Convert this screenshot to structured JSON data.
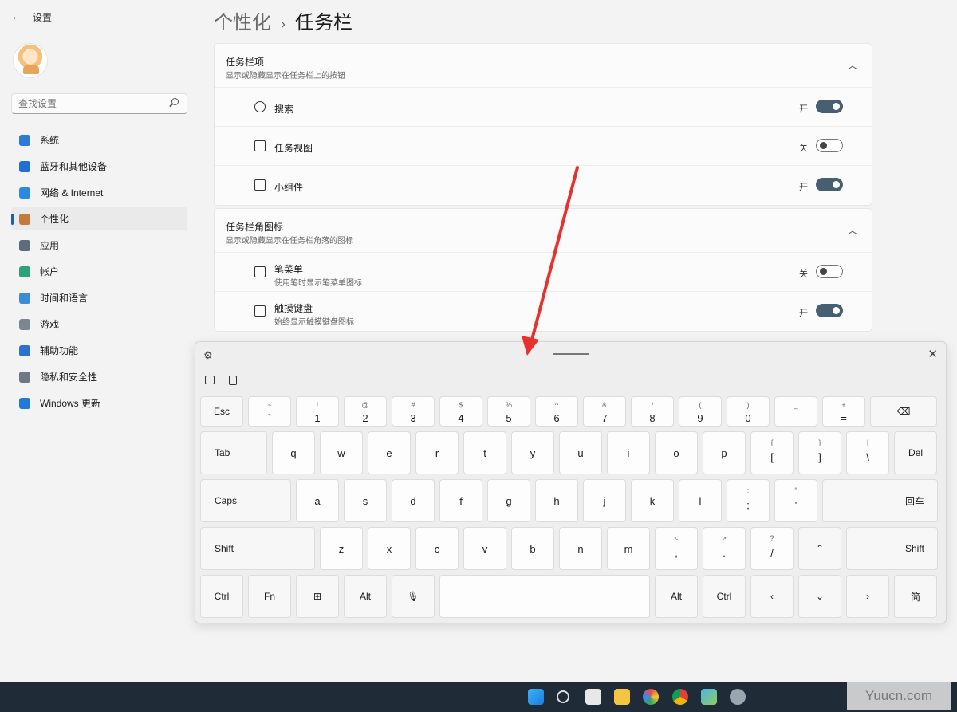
{
  "app": {
    "back_glyph": "←",
    "title": "设置"
  },
  "search": {
    "placeholder": "查找设置"
  },
  "sidebar": {
    "items": [
      {
        "label": "系统",
        "color": "#2d7bd4"
      },
      {
        "label": "蓝牙和其他设备",
        "color": "#1f6fd6"
      },
      {
        "label": "网络 & Internet",
        "color": "#2b8ae0"
      },
      {
        "label": "个性化",
        "color": "#c47a3a"
      },
      {
        "label": "应用",
        "color": "#5a6c7d"
      },
      {
        "label": "帐户",
        "color": "#2aa37a"
      },
      {
        "label": "时间和语言",
        "color": "#3a8dd6"
      },
      {
        "label": "游戏",
        "color": "#7a8793"
      },
      {
        "label": "辅助功能",
        "color": "#2c73cf"
      },
      {
        "label": "隐私和安全性",
        "color": "#6d7a86"
      },
      {
        "label": "Windows 更新",
        "color": "#1f7bd6"
      }
    ],
    "active_index": 3
  },
  "breadcrumb": {
    "parent": "个性化",
    "separator": "›",
    "current": "任务栏"
  },
  "taskbar_items": {
    "title": "任务栏项",
    "subtitle": "显示或隐藏显示在任务栏上的按钮",
    "rows": [
      {
        "label": "搜索",
        "state": "开",
        "on": true
      },
      {
        "label": "任务视图",
        "state": "关",
        "on": false
      },
      {
        "label": "小组件",
        "state": "开",
        "on": true
      }
    ]
  },
  "corner_icons": {
    "title": "任务栏角图标",
    "subtitle": "显示或隐藏显示在任务栏角落的图标",
    "rows": [
      {
        "label": "笔菜单",
        "desc": "使用笔时显示笔菜单图标",
        "state": "关",
        "on": false
      },
      {
        "label": "触摸键盘",
        "desc": "始终显示触摸键盘图标",
        "state": "开",
        "on": true
      }
    ]
  },
  "keyboard": {
    "gear": "⚙",
    "close": "✕",
    "row1": [
      {
        "up": "",
        "lo": "Esc"
      },
      {
        "up": "~",
        "lo": "`"
      },
      {
        "up": "!",
        "lo": "1"
      },
      {
        "up": "@",
        "lo": "2"
      },
      {
        "up": "#",
        "lo": "3"
      },
      {
        "up": "$",
        "lo": "4"
      },
      {
        "up": "%",
        "lo": "5"
      },
      {
        "up": "^",
        "lo": "6"
      },
      {
        "up": "&",
        "lo": "7"
      },
      {
        "up": "*",
        "lo": "8"
      },
      {
        "up": "(",
        "lo": "9"
      },
      {
        "up": ")",
        "lo": "0"
      },
      {
        "up": "_",
        "lo": "-"
      },
      {
        "up": "+",
        "lo": "="
      },
      {
        "up": "",
        "lo": "⌫"
      }
    ],
    "row2": [
      "Tab",
      "q",
      "w",
      "e",
      "r",
      "t",
      "y",
      "u",
      "i",
      "o",
      "p"
    ],
    "row2_sym": [
      {
        "up": "{",
        "lo": "["
      },
      {
        "up": "}",
        "lo": "]"
      },
      {
        "up": "|",
        "lo": "\\"
      }
    ],
    "row2_end": "Del",
    "row3": [
      "Caps",
      "a",
      "s",
      "d",
      "f",
      "g",
      "h",
      "j",
      "k",
      "l"
    ],
    "row3_sym": [
      {
        "up": ":",
        "lo": ";"
      },
      {
        "up": "\"",
        "lo": "'"
      }
    ],
    "row3_end": "回车",
    "row4": [
      "Shift",
      "z",
      "x",
      "c",
      "v",
      "b",
      "n",
      "m"
    ],
    "row4_sym": [
      {
        "up": "<",
        "lo": ","
      },
      {
        "up": ">",
        "lo": "."
      },
      {
        "up": "?",
        "lo": "/"
      }
    ],
    "row4_up": "⌃",
    "row4_end": "Shift",
    "row5": [
      "Ctrl",
      "Fn",
      "⊞",
      "Alt",
      "🎙",
      "",
      "Alt",
      "Ctrl",
      "‹",
      "⌄",
      "›",
      "简"
    ]
  },
  "watermark": "Yuucn.com",
  "arrow_color": "#e8302c"
}
